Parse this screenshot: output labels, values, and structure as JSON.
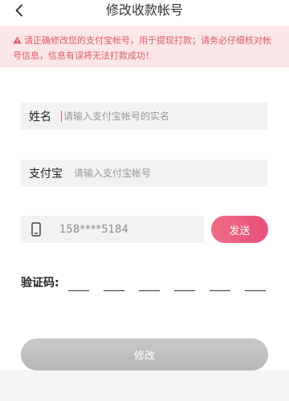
{
  "header": {
    "title": "修改收款帐号",
    "back_icon": "chevron-left-icon"
  },
  "notice": {
    "icon": "warning-triangle-icon",
    "color": "#e25a67",
    "background": "#fbe6e8",
    "text": "请正确修改您的支付宝帐号，用于提现打款；请务必仔细核对帐号信息，信息有误将无法打款成功！"
  },
  "form": {
    "name": {
      "label": "姓名",
      "placeholder": "请输入支付宝帐号的实名"
    },
    "alipay": {
      "label": "支付宝",
      "placeholder": "请输入支付宝帐号"
    },
    "phone": {
      "icon": "phone-icon",
      "value": "158****5184"
    },
    "send_button": "发送",
    "code_label": "验证码:",
    "code_digits": [
      "",
      "",
      "",
      "",
      "",
      ""
    ]
  },
  "submit_button": "修改",
  "colors": {
    "accent": "#e9507a",
    "disabled": "#bdbdbd"
  }
}
